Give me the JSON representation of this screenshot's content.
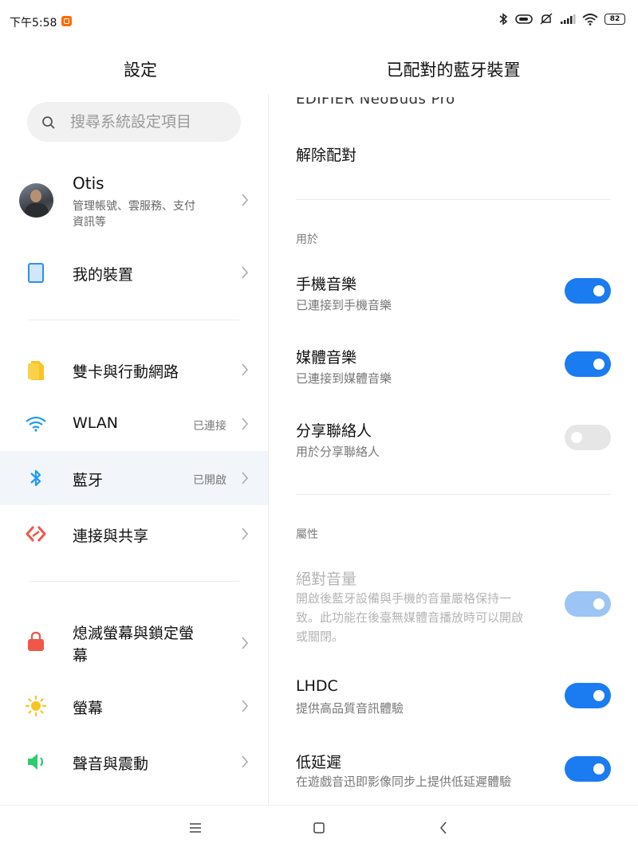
{
  "status_bar": {
    "time": "下午5:58",
    "battery": "82",
    "icons": [
      "bluetooth-icon",
      "headset-battery-icon",
      "mute-icon",
      "signal-icon",
      "wifi-icon",
      "battery-icon"
    ]
  },
  "left": {
    "title": "設定",
    "search_placeholder": "搜尋系統設定項目",
    "profile": {
      "name": "Otis",
      "desc_line1": "管理帳號、雲服務、支付",
      "desc_line2": "資訊等"
    },
    "items": [
      {
        "id": "my-device",
        "label": "我的裝置",
        "icon": "tablet-icon"
      },
      {
        "id": "sim",
        "label": "雙卡與行動網路",
        "icon": "sim-icon"
      },
      {
        "id": "wlan",
        "label": "WLAN",
        "status": "已連接",
        "icon": "wifi-icon"
      },
      {
        "id": "bluetooth",
        "label": "藍牙",
        "status": "已開啟",
        "icon": "bluetooth-icon"
      },
      {
        "id": "share",
        "label": "連接與共享",
        "icon": "share-icon"
      },
      {
        "id": "lock",
        "label_line1": "熄滅螢幕與鎖定螢",
        "label_line2": "幕",
        "icon": "lock-icon"
      },
      {
        "id": "display",
        "label": "螢幕",
        "icon": "sun-icon"
      },
      {
        "id": "sound",
        "label": "聲音與震動",
        "icon": "speaker-icon"
      }
    ]
  },
  "right": {
    "title": "已配對的藍牙裝置",
    "device_name_partial": "EDIFIER NeoBuds Pro",
    "unpair": "解除配對",
    "section_use": "用於",
    "settings": [
      {
        "id": "phone-audio",
        "title": "手機音樂",
        "sub": "已連接到手機音樂",
        "on": true
      },
      {
        "id": "media-audio",
        "title": "媒體音樂",
        "sub": "已連接到媒體音樂",
        "on": true
      },
      {
        "id": "contacts",
        "title": "分享聯絡人",
        "sub": "用於分享聯絡人",
        "on": false
      }
    ],
    "section_props": "屬性",
    "absolute_volume": {
      "title": "絕對音量",
      "sub_line1": "開啟後藍牙設備與手機的音量嚴格保持一",
      "sub_line2": "致。此功能在後臺無媒體音播放時可以開啟",
      "sub_line3": "或關閉。",
      "on": true,
      "disabled": true
    },
    "lhdc": {
      "title": "LHDC",
      "sub": "提供高品質音訊體驗",
      "on": true
    },
    "low_latency": {
      "title": "低延遲",
      "sub": "在遊戲音迅即影像同步上提供低延遲體驗",
      "on": true
    }
  },
  "colors": {
    "accent": "#1a7cf0",
    "selected_row": "#f2f6fb",
    "toggle_off": "#e6e6e6"
  }
}
